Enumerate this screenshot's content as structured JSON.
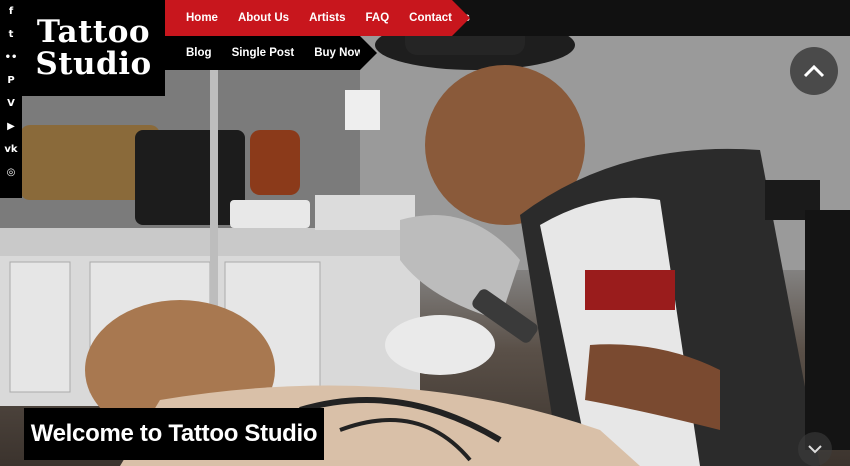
{
  "brand": {
    "line1": "Tattoo",
    "line2": "Studio"
  },
  "nav_primary": [
    "Home",
    "About Us",
    "Artists",
    "FAQ",
    "Contact Us"
  ],
  "nav_secondary": [
    "Blog",
    "Single Post",
    "Buy Now!"
  ],
  "social": [
    {
      "icon": "facebook-icon",
      "glyph": "f"
    },
    {
      "icon": "twitter-icon",
      "glyph": "t"
    },
    {
      "icon": "flickr-icon",
      "glyph": "••"
    },
    {
      "icon": "pinterest-icon",
      "glyph": "P"
    },
    {
      "icon": "vimeo-icon",
      "glyph": "V"
    },
    {
      "icon": "youtube-icon",
      "glyph": "▶"
    },
    {
      "icon": "vk-icon",
      "glyph": "vk"
    },
    {
      "icon": "instagram-icon",
      "glyph": "◎"
    }
  ],
  "hero": {
    "heading": "Welcome to Tattoo Studio"
  },
  "colors": {
    "accent": "#c8161d",
    "dark": "#000000"
  }
}
